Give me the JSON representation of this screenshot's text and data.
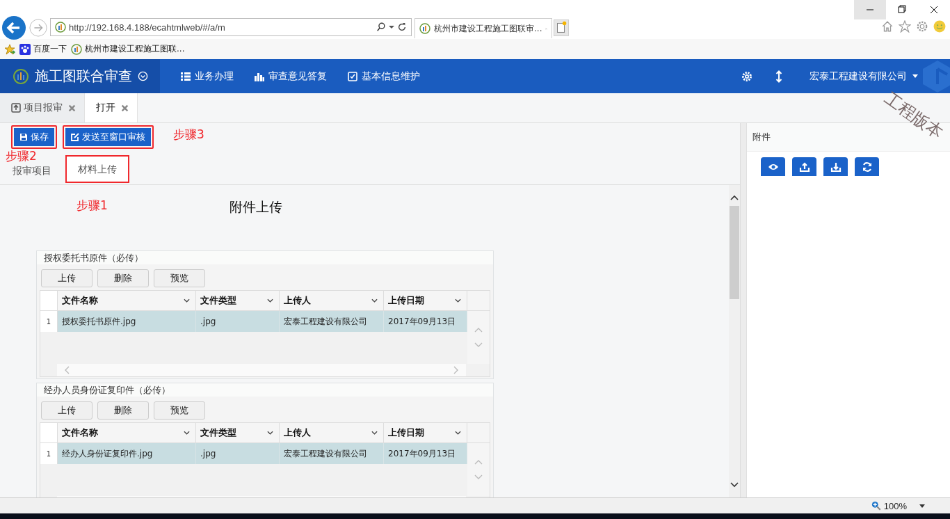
{
  "browser": {
    "url": "http://192.168.4.188/ecahtmlweb/#/a/m",
    "tab_title": "杭州市建设工程施工图联审...",
    "favorites": [
      "百度一下",
      "杭州市建设工程施工图联..."
    ],
    "zoom": "100%"
  },
  "app": {
    "title": "施工图联合审查",
    "nav": [
      "业务办理",
      "审查意见答复",
      "基本信息维护"
    ],
    "user": "宏泰工程建设有限公司",
    "version_stamp": "工程版本"
  },
  "page_tabs": [
    {
      "label": "项目报审",
      "selected": false
    },
    {
      "label": "打开",
      "selected": true
    }
  ],
  "toolbar_buttons": [
    {
      "label": "保存",
      "annotated": true
    },
    {
      "label": "发送至窗口审核",
      "annotated": true
    }
  ],
  "sub_tabs": [
    {
      "label": "报审项目",
      "selected": false,
      "annotated": false
    },
    {
      "label": "材料上传",
      "selected": true,
      "annotated": true
    }
  ],
  "annotations": [
    "步骤1",
    "步骤2",
    "步骤3"
  ],
  "heading": "附件上传",
  "sections": [
    {
      "title": "授权委托书原件（必传）",
      "buttons": [
        "上传",
        "删除",
        "预览"
      ],
      "columns": [
        "文件名称",
        "文件类型",
        "上传人",
        "上传日期"
      ],
      "rows": [
        {
          "number": "1",
          "cells": [
            "授权委托书原件.jpg",
            ".jpg",
            "宏泰工程建设有限公司",
            "2017年09月13日"
          ],
          "selected": true
        }
      ]
    },
    {
      "title": "经办人员身份证复印件（必传）",
      "buttons": [
        "上传",
        "删除",
        "预览"
      ],
      "columns": [
        "文件名称",
        "文件类型",
        "上传人",
        "上传日期"
      ],
      "rows": [
        {
          "number": "1",
          "cells": [
            "经办人身份证复印件.jpg",
            ".jpg",
            "宏泰工程建设有限公司",
            "2017年09月13日"
          ],
          "selected": true
        }
      ]
    }
  ],
  "side_panel": {
    "title": "附件"
  }
}
